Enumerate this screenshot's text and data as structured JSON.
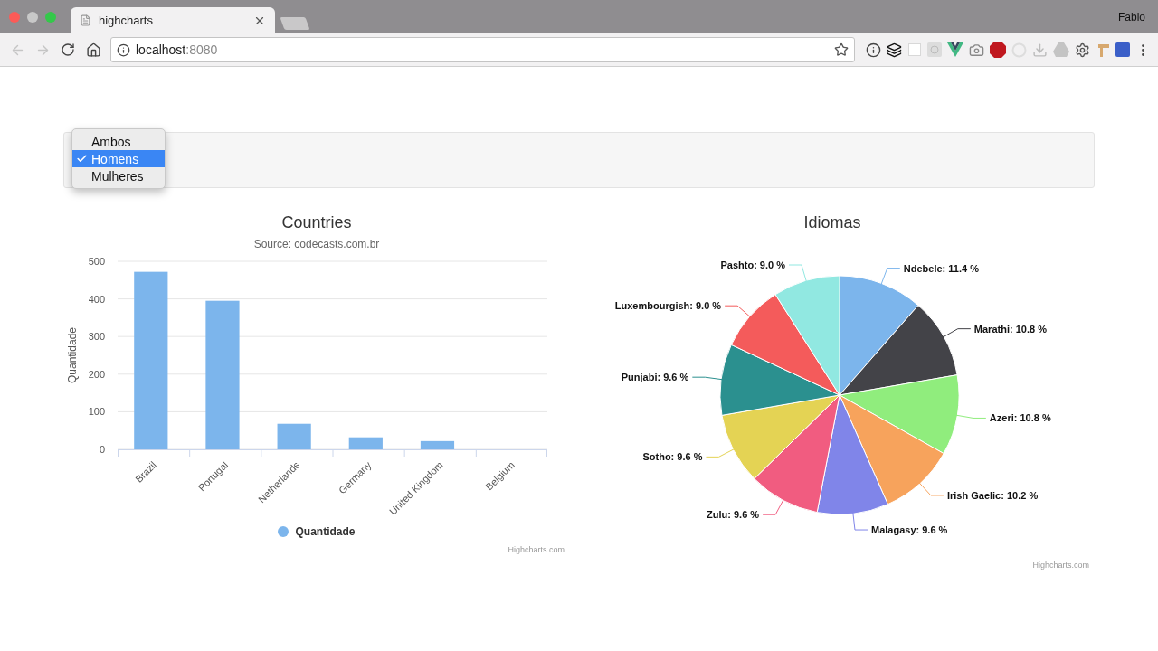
{
  "browser": {
    "tab_title": "highcharts",
    "profile": "Fabio",
    "url_host": "localhost",
    "url_port": ":8080"
  },
  "filter": {
    "options": [
      {
        "label": "Ambos",
        "selected": false
      },
      {
        "label": "Homens",
        "selected": true
      },
      {
        "label": "Mulheres",
        "selected": false
      }
    ]
  },
  "bar_chart": {
    "subtitle": "Source: codecasts.com.br",
    "credits": "Highcharts.com",
    "chart_data": {
      "type": "bar",
      "grid": true,
      "title": "Countries",
      "ylabel": "Quantidade",
      "categories": [
        "Brazil",
        "Portugal",
        "Netherlands",
        "Germany",
        "United Kingdom",
        "Belgium"
      ],
      "series": [
        {
          "name": "Quantidade",
          "color": "#7cb5ec",
          "values": [
            472,
            395,
            68,
            32,
            22,
            0
          ]
        }
      ],
      "ylim": [
        0,
        500
      ],
      "yticks": [
        0,
        100,
        200,
        300,
        400,
        500
      ]
    }
  },
  "pie_chart": {
    "credits": "Highcharts.com",
    "chart_data": {
      "type": "pie",
      "title": "Idiomas",
      "values": [
        11.4,
        10.8,
        10.8,
        10.2,
        9.6,
        9.6,
        9.6,
        9.6,
        9.0,
        9.0
      ],
      "value_labels": [
        "Ndebele: 11.4 %",
        "Marathi: 10.8 %",
        "Azeri: 10.8 %",
        "Irish Gaelic: 10.2 %",
        "Malagasy: 9.6 %",
        "Zulu: 9.6 %",
        "Sotho: 9.6 %",
        "Punjabi: 9.6 %",
        "Luxembourgish: 9.0 %",
        "Pashto: 9.0 %"
      ]
    }
  }
}
